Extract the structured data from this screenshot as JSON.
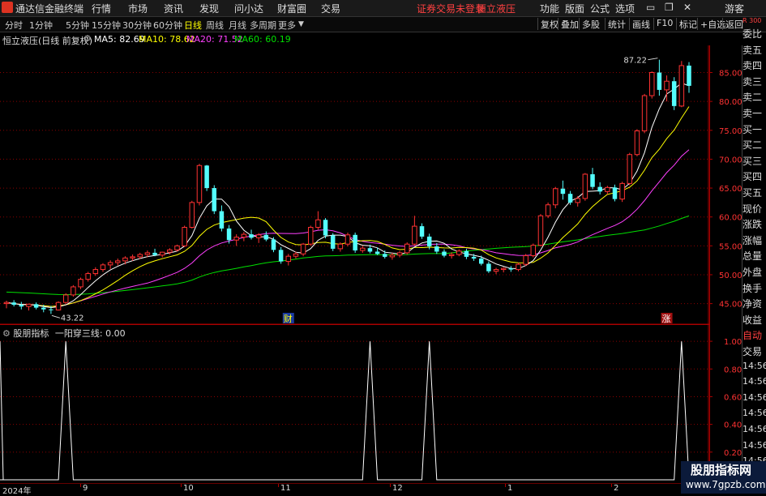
{
  "menubar": {
    "app_title": "通达信金融终端",
    "menus": [
      "行情",
      "市场",
      "资讯",
      "发现",
      "问小达",
      "财富圈",
      "交易"
    ],
    "status_notice": "证券交易未登录",
    "stock_name": "恒立液压",
    "right_menus": [
      "功能",
      "版面",
      "公式",
      "选项"
    ],
    "guest": "游客"
  },
  "toolbar": {
    "periods": [
      "分时",
      "1分钟",
      "5分钟",
      "15分钟",
      "30分钟",
      "60分钟",
      "日线",
      "周线",
      "月线",
      "多周期",
      "更多"
    ],
    "active_period": "日线",
    "right_buttons": [
      "复权",
      "叠加",
      "多股",
      "统计",
      "画线",
      "F10",
      "标记",
      "+自选",
      "返回"
    ]
  },
  "chart_title": {
    "name": "恒立液压(日线 前复权)",
    "ma5": "MA5: 82.69",
    "ma10": "MA10: 78.62",
    "ma20": "MA20: 71.52",
    "ma60": "MA60: 60.19"
  },
  "annotations": {
    "high": "87.22",
    "low": "43.22",
    "cai": "财",
    "zhang": "涨"
  },
  "indicator": {
    "name": "股朋指标",
    "line_label": "一阳穿三线: 0.00"
  },
  "price_axis": [
    "85.00",
    "80.00",
    "75.00",
    "70.00",
    "65.00",
    "60.00",
    "55.00",
    "50.00",
    "45.00"
  ],
  "indicator_axis": [
    "1.00",
    "0.80",
    "0.60",
    "0.40",
    "0.20"
  ],
  "dates": [
    "2024年",
    "9",
    "10",
    "11",
    "12",
    "1",
    "2"
  ],
  "sidebar_items": [
    "委比",
    "卖五",
    "卖四",
    "卖三",
    "卖二",
    "卖一",
    "买一",
    "买二",
    "买三",
    "买四",
    "买五",
    "现价",
    "涨跌",
    "涨幅",
    "总量",
    "外盘",
    "换手",
    "净资",
    "收益",
    "自动",
    "交易",
    "14:56",
    "14:56",
    "14:56",
    "14:56",
    "14:56",
    "14:56",
    "14:56",
    "14:56"
  ],
  "sidebar_top": "R 300",
  "watermark": {
    "line1": "股朋指标网",
    "line2": "www.7gpzb.com"
  },
  "colors": {
    "up": "#ff3232",
    "down": "#54ffff",
    "ma5": "#ffffff",
    "ma10": "#ffff00",
    "ma20": "#ff40ff",
    "ma60": "#00e000",
    "grid": "#8b0000"
  },
  "chart_data": {
    "type": "candlestick",
    "y_range": [
      42,
      89
    ],
    "indicator_range": [
      0,
      1.1
    ],
    "candles": [
      [
        45,
        45.5,
        44.2,
        45.2
      ],
      [
        45.2,
        45.6,
        44.5,
        44.8
      ],
      [
        44.8,
        45.3,
        44,
        44.5
      ],
      [
        44.5,
        45,
        43.8,
        44.9
      ],
      [
        44.9,
        45.2,
        44,
        44.3
      ],
      [
        44.3,
        44.8,
        43.5,
        44
      ],
      [
        44,
        44.6,
        43.22,
        43.9
      ],
      [
        43.9,
        45.4,
        43.8,
        45.2
      ],
      [
        45.2,
        46.8,
        45,
        46.5
      ],
      [
        46.5,
        48.2,
        46.2,
        47.9
      ],
      [
        47.9,
        49.5,
        47.5,
        49.2
      ],
      [
        49.2,
        50.5,
        48.8,
        50.2
      ],
      [
        50.2,
        51.3,
        49.8,
        50.9
      ],
      [
        50.9,
        52,
        50.5,
        51.7
      ],
      [
        51.7,
        52.5,
        51,
        52.1
      ],
      [
        52.1,
        52.8,
        51.6,
        52.4
      ],
      [
        52.4,
        53.2,
        51.8,
        52.9
      ],
      [
        52.9,
        53.5,
        52.4,
        53.1
      ],
      [
        53.1,
        53.8,
        52.7,
        53.5
      ],
      [
        53.5,
        54.2,
        53,
        53.8
      ],
      [
        53.8,
        54.5,
        53.2,
        53.4
      ],
      [
        53.4,
        54,
        53,
        53.9
      ],
      [
        53.9,
        54.6,
        53.5,
        54.3
      ],
      [
        54.3,
        55.2,
        54,
        55
      ],
      [
        55,
        58.5,
        54.8,
        58.2
      ],
      [
        58.2,
        62.8,
        58,
        62.5
      ],
      [
        62.5,
        69.2,
        62,
        68.9
      ],
      [
        68.9,
        69,
        64.5,
        65
      ],
      [
        65,
        65.5,
        60.5,
        61
      ],
      [
        61,
        62,
        57.5,
        58
      ],
      [
        58,
        58.6,
        55.4,
        56
      ],
      [
        56,
        57,
        55,
        56.5
      ],
      [
        56.5,
        57.4,
        55.8,
        57
      ],
      [
        57,
        57.8,
        56.1,
        56.4
      ],
      [
        56.4,
        57.2,
        55.5,
        56.9
      ],
      [
        56.9,
        57.5,
        55.8,
        56.1
      ],
      [
        56.1,
        56.5,
        53.9,
        54.3
      ],
      [
        54.3,
        54.8,
        51.9,
        52.3
      ],
      [
        52.3,
        53.6,
        51.6,
        53.2
      ],
      [
        53.2,
        54,
        52.8,
        53.6
      ],
      [
        53.6,
        55.5,
        53.2,
        55.3
      ],
      [
        55.3,
        58.5,
        55,
        58.2
      ],
      [
        58.2,
        61,
        57.8,
        59.5
      ],
      [
        59.5,
        59.8,
        56.3,
        56.8
      ],
      [
        56.8,
        57.2,
        54.1,
        54.5
      ],
      [
        54.5,
        55.6,
        54,
        55.3
      ],
      [
        55.3,
        57.3,
        54.9,
        56.9
      ],
      [
        56.9,
        57.3,
        53.8,
        54.2
      ],
      [
        54.2,
        55,
        53.8,
        54.6
      ],
      [
        54.6,
        55.2,
        53.7,
        54
      ],
      [
        54,
        54.7,
        53.4,
        53.6
      ],
      [
        53.6,
        54.2,
        52.8,
        53.1
      ],
      [
        53.1,
        53.8,
        52.6,
        53.4
      ],
      [
        53.4,
        54.1,
        53,
        53.8
      ],
      [
        53.8,
        55.6,
        53.5,
        55.3
      ],
      [
        55.3,
        60.2,
        55,
        58.4
      ],
      [
        58.4,
        58.9,
        56.2,
        56.6
      ],
      [
        56.6,
        57.1,
        54.4,
        54.9
      ],
      [
        54.9,
        55.5,
        53.6,
        54
      ],
      [
        54,
        54.4,
        53,
        53.3
      ],
      [
        53.3,
        53.9,
        52.8,
        53.5
      ],
      [
        53.5,
        54.4,
        53.2,
        54.1
      ],
      [
        54.1,
        54.5,
        52.7,
        53.1
      ],
      [
        53.1,
        53.6,
        52.4,
        52.8
      ],
      [
        52.8,
        53.3,
        51.6,
        51.9
      ],
      [
        51.9,
        52.3,
        50.3,
        50.6
      ],
      [
        50.6,
        51.2,
        50.1,
        50.9
      ],
      [
        50.9,
        51.3,
        50.4,
        51.1
      ],
      [
        51.1,
        51.5,
        50.5,
        50.9
      ],
      [
        50.9,
        52.1,
        50.6,
        51.8
      ],
      [
        51.8,
        53.6,
        51.5,
        53.3
      ],
      [
        53.3,
        55.4,
        53,
        55.1
      ],
      [
        55.1,
        60.5,
        54.9,
        60.2
      ],
      [
        60.2,
        62.5,
        59.8,
        62.1
      ],
      [
        62.1,
        65.2,
        61.5,
        64.9
      ],
      [
        64.9,
        66.3,
        63,
        64
      ],
      [
        64,
        64.5,
        62.1,
        62.5
      ],
      [
        62.5,
        63.6,
        61.8,
        63.2
      ],
      [
        63.2,
        67.6,
        62.8,
        67.4
      ],
      [
        67.4,
        68.5,
        64.8,
        65.2
      ],
      [
        65.2,
        66,
        63.9,
        64.4
      ],
      [
        64.4,
        65.4,
        63.9,
        65.1
      ],
      [
        65.1,
        65.6,
        62.7,
        63.1
      ],
      [
        63.1,
        66.1,
        62.6,
        65.8
      ],
      [
        65.8,
        71.1,
        65.5,
        70.8
      ],
      [
        70.8,
        75.2,
        70.5,
        74.9
      ],
      [
        74.9,
        81.3,
        74.5,
        81
      ],
      [
        81,
        85.2,
        80.5,
        85
      ],
      [
        85,
        87.22,
        81,
        82
      ],
      [
        82,
        84.5,
        80,
        83.5
      ],
      [
        83.5,
        84.2,
        78.5,
        79.2
      ],
      [
        79.2,
        87,
        79,
        86.2
      ],
      [
        86.2,
        86.8,
        81.5,
        82.7
      ]
    ],
    "signal_indices": [
      8,
      49,
      57,
      91
    ]
  }
}
